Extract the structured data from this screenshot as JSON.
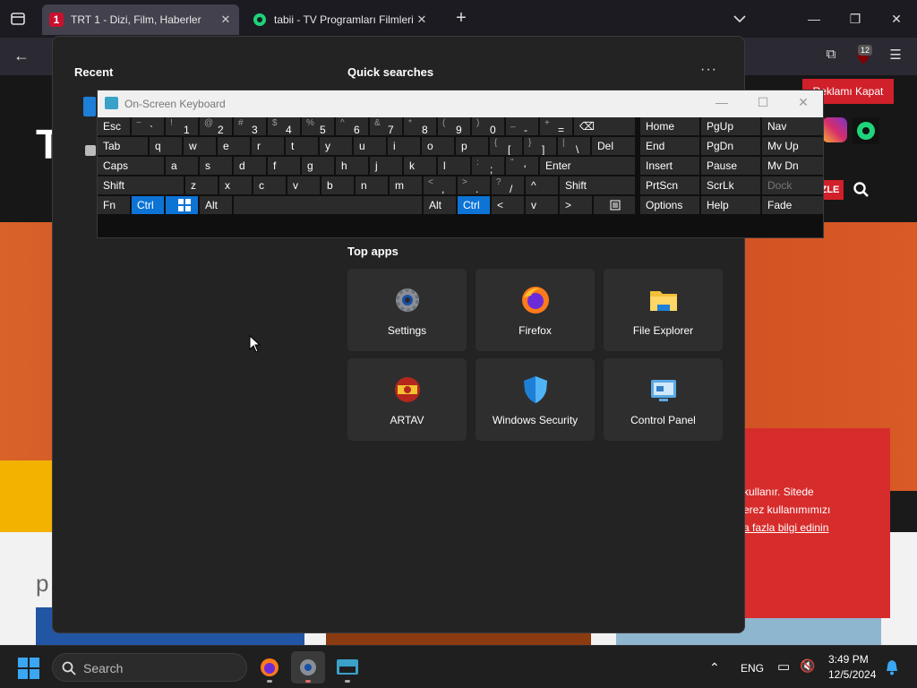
{
  "browser": {
    "tabs": [
      {
        "favicon": "1",
        "title": "TRT 1 - Dizi, Film, Haberler",
        "active": true
      },
      {
        "favicon": "tabii-icon",
        "title": "tabii - TV Programları Filmleri ve",
        "active": false
      }
    ],
    "extension_badge": "12",
    "colors": {
      "chrome": "#1c1b22",
      "active_tab": "#42414d",
      "toolbar": "#2b2a33"
    }
  },
  "webpage": {
    "header_letter": "T",
    "ad_button": "Reklamı Kapat",
    "izle_button": "ZLE",
    "cookie_lines": [
      "kullanır. Sitede",
      "erez kullanımımızı",
      "a fazla bilgi edinin"
    ],
    "partial_letter": "p",
    "colors": {
      "brand_red": "#d0202a",
      "orange": "#d9481a"
    }
  },
  "start_menu": {
    "recent_heading": "Recent",
    "quick_searches_heading": "Quick searches",
    "more_label": "···",
    "top_apps_heading": "Top apps",
    "top_apps": [
      {
        "label": "Settings",
        "icon": "gear-icon"
      },
      {
        "label": "Firefox",
        "icon": "firefox-icon"
      },
      {
        "label": "File Explorer",
        "icon": "folder-icon"
      },
      {
        "label": "ARTAV",
        "icon": "artav-icon"
      },
      {
        "label": "Windows Security",
        "icon": "shield-icon"
      },
      {
        "label": "Control Panel",
        "icon": "control-panel-icon"
      }
    ]
  },
  "osk": {
    "title": "On-Screen Keyboard",
    "rows": [
      [
        {
          "l": "Esc"
        },
        {
          "s": "~",
          "l": "`"
        },
        {
          "s": "!",
          "l": "1"
        },
        {
          "s": "@",
          "l": "2"
        },
        {
          "s": "#",
          "l": "3"
        },
        {
          "s": "$",
          "l": "4"
        },
        {
          "s": "%",
          "l": "5"
        },
        {
          "s": "^",
          "l": "6"
        },
        {
          "s": "&",
          "l": "7"
        },
        {
          "s": "*",
          "l": "8"
        },
        {
          "s": "(",
          "l": "9"
        },
        {
          "s": ")",
          "l": "0"
        },
        {
          "s": "_",
          "l": "-"
        },
        {
          "s": "+",
          "l": "="
        },
        {
          "l": "⌫"
        }
      ],
      [
        {
          "l": "Tab"
        },
        {
          "l": "q"
        },
        {
          "l": "w"
        },
        {
          "l": "e"
        },
        {
          "l": "r"
        },
        {
          "l": "t"
        },
        {
          "l": "y"
        },
        {
          "l": "u"
        },
        {
          "l": "i"
        },
        {
          "l": "o"
        },
        {
          "l": "p"
        },
        {
          "s": "{",
          "l": "["
        },
        {
          "s": "}",
          "l": "]"
        },
        {
          "s": "|",
          "l": "\\"
        },
        {
          "l": "Del"
        }
      ],
      [
        {
          "l": "Caps"
        },
        {
          "l": "a"
        },
        {
          "l": "s"
        },
        {
          "l": "d"
        },
        {
          "l": "f"
        },
        {
          "l": "g"
        },
        {
          "l": "h"
        },
        {
          "l": "j"
        },
        {
          "l": "k"
        },
        {
          "l": "l"
        },
        {
          "s": ":",
          "l": ";"
        },
        {
          "s": "\"",
          "l": "'"
        },
        {
          "l": "Enter"
        }
      ],
      [
        {
          "l": "Shift"
        },
        {
          "l": "z"
        },
        {
          "l": "x"
        },
        {
          "l": "c"
        },
        {
          "l": "v"
        },
        {
          "l": "b"
        },
        {
          "l": "n"
        },
        {
          "l": "m"
        },
        {
          "s": "<",
          "l": ","
        },
        {
          "s": ">",
          "l": "."
        },
        {
          "s": "?",
          "l": "/"
        },
        {
          "l": "^"
        },
        {
          "l": "Shift"
        }
      ],
      [
        {
          "l": "Fn"
        },
        {
          "l": "Ctrl"
        },
        {
          "l": "win-icon"
        },
        {
          "l": "Alt"
        },
        {
          "l": ""
        },
        {
          "l": "Alt"
        },
        {
          "l": "Ctrl"
        },
        {
          "l": "<"
        },
        {
          "l": "v"
        },
        {
          "l": ">"
        },
        {
          "l": "menu-icon"
        }
      ]
    ],
    "nav_rows": [
      [
        "Home",
        "PgUp",
        "Nav"
      ],
      [
        "End",
        "PgDn",
        "Mv Up"
      ],
      [
        "Insert",
        "Pause",
        "Mv Dn"
      ],
      [
        "PrtScn",
        "ScrLk",
        "Dock"
      ],
      [
        "Options",
        "Help",
        "Fade"
      ]
    ],
    "colors": {
      "key": "#2b2b2b",
      "active_key": "#0d74d6",
      "background": "#0f0f0f"
    }
  },
  "taskbar": {
    "search_placeholder": "Search",
    "language": "ENG",
    "time": "3:49 PM",
    "date": "12/5/2024",
    "accent": "#3aa7f3"
  }
}
